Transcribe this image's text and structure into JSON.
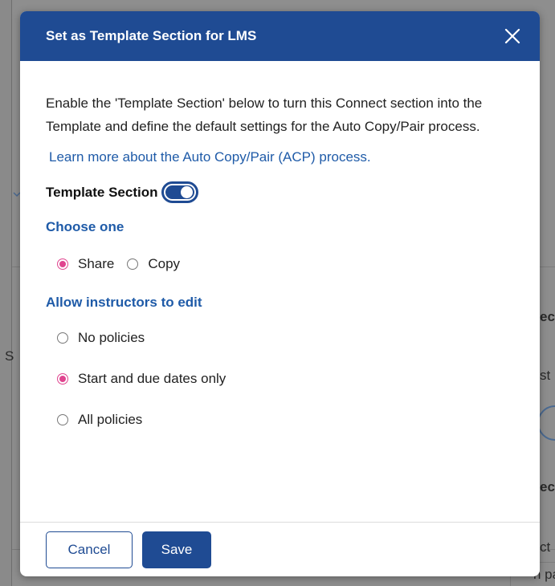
{
  "dialog": {
    "title": "Set as Template Section for LMS",
    "intro": "Enable the 'Template Section' below to turn this Connect section into the Template and define the default settings for the Auto Copy/Pair process.",
    "learn_more_link": "Learn more about the Auto Copy/Pair (ACP) process.",
    "toggle_label": "Template Section",
    "toggle_on": true,
    "choose_heading": "Choose one",
    "choose_options": [
      {
        "label": "Share",
        "selected": true
      },
      {
        "label": "Copy",
        "selected": false
      }
    ],
    "edit_heading": "Allow instructors to edit",
    "edit_options": [
      {
        "label": "No policies",
        "selected": false
      },
      {
        "label": "Start and due dates only",
        "selected": true
      },
      {
        "label": "All policies",
        "selected": false
      }
    ],
    "cancel_label": "Cancel",
    "save_label": "Save"
  },
  "background": {
    "fragments": [
      "S",
      "ec",
      "st",
      "ec",
      "ct",
      "n pa"
    ]
  },
  "colors": {
    "header": "#1f4b93",
    "link": "#1f5ba8",
    "radio_selected": "#e0448f",
    "overlay": "#8a8a8a"
  },
  "icons": {
    "close": "close-icon",
    "background_chevron": "chevron-down-icon"
  }
}
